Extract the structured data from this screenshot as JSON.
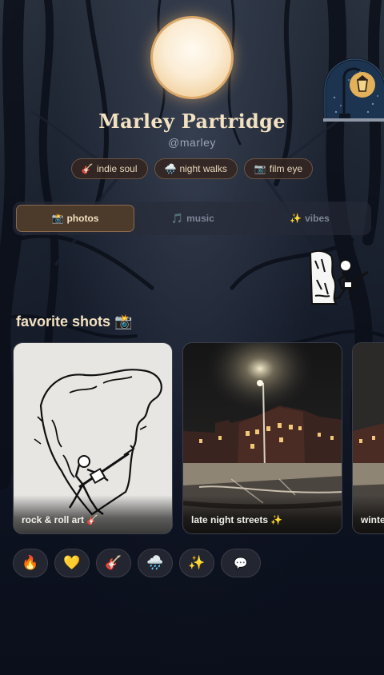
{
  "profile": {
    "name": "Marley Partridge",
    "handle": "@marley"
  },
  "chips": [
    {
      "icon": "🎸",
      "label": "indie soul"
    },
    {
      "icon": "🌧️",
      "label": "night walks"
    },
    {
      "icon": "📷",
      "label": "film eye"
    }
  ],
  "tabs": [
    {
      "icon": "📸",
      "label": "photos",
      "active": true
    },
    {
      "icon": "🎵",
      "label": "music",
      "active": false
    },
    {
      "icon": "✨",
      "label": "vibes",
      "active": false
    }
  ],
  "section": {
    "title": "favorite shots 📸"
  },
  "cards": [
    {
      "caption": "rock & roll art 🎸"
    },
    {
      "caption": "late night streets ✨"
    },
    {
      "caption": "winter"
    }
  ],
  "reactions": [
    "🔥",
    "💛",
    "🎸",
    "🌧️",
    "✨",
    "💬"
  ],
  "colors": {
    "accent": "#d9a86a",
    "background": "#0d1220",
    "text": "#f3e2c1"
  }
}
